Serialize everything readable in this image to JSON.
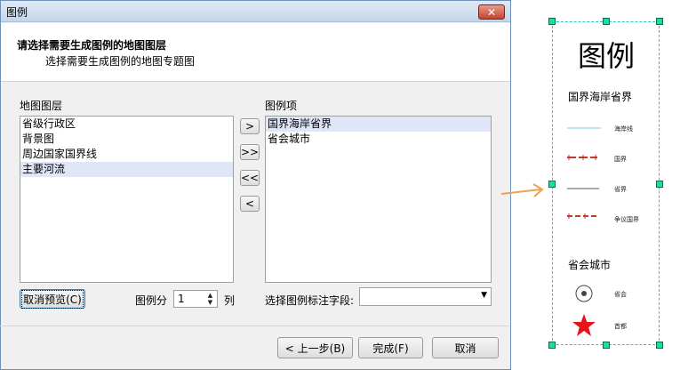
{
  "window": {
    "title": "图例",
    "close_symbol": "✕"
  },
  "header": {
    "title": "请选择需要生成图例的地图图层",
    "subtitle": "选择需要生成图例的地图专题图"
  },
  "left_list": {
    "label": "地图图层",
    "items": [
      "省级行政区",
      "背景图",
      "周边国家国界线",
      "主要河流"
    ]
  },
  "move_buttons": [
    ">",
    ">>",
    "<<",
    "<"
  ],
  "right_list": {
    "label": "图例项",
    "items": [
      "国界海岸省界",
      "省会城市"
    ]
  },
  "controls": {
    "cancel_preview": "取消预览(C)",
    "columns_label": "图例分",
    "columns_value": "1",
    "columns_unit": "列",
    "field_label": "选择图例标注字段:",
    "field_value": ""
  },
  "footer": {
    "back": "< 上一步(B)",
    "finish": "完成(F)",
    "cancel": "取消"
  },
  "legend": {
    "title": "图例",
    "section1": "国界海岸省界",
    "items1": [
      "海岸线",
      "国界",
      "省界",
      "争议国界"
    ],
    "section2": "省会城市",
    "items2": [
      "省会",
      "首都"
    ],
    "colors": {
      "coast": "#7fc9e0",
      "border_red": "#c0392b",
      "capital_star": "#e8141c",
      "arrow": "#f0a050",
      "frame": "#2fc3c3"
    }
  }
}
